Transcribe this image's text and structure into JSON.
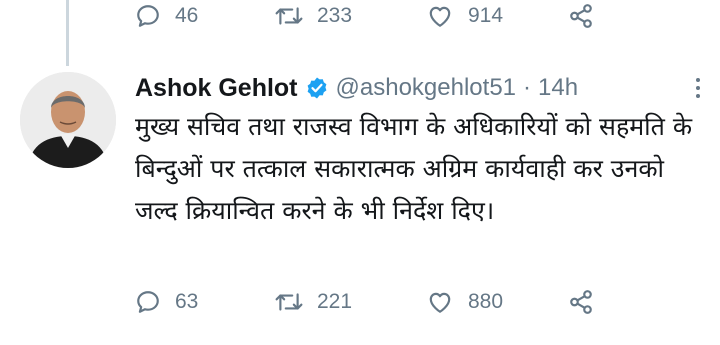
{
  "previous_tweet": {
    "actions": {
      "reply_count": "46",
      "retweet_count": "233",
      "like_count": "914"
    }
  },
  "tweet": {
    "author": {
      "display_name": "Ashok Gehlot",
      "handle": "@ashokgehlot51",
      "verified": true
    },
    "separator": "·",
    "time": "14h",
    "text": "मुख्य सचिव तथा राजस्व विभाग के अधिकारियों को सहमति के बिन्दुओं पर तत्काल सकारात्मक अग्रिम कार्यवाही कर उनको जल्द क्रियान्वित करने के भी निर्देश दिए।",
    "actions": {
      "reply_count": "63",
      "retweet_count": "221",
      "like_count": "880"
    }
  },
  "icons": {
    "reply": "reply-icon",
    "retweet": "retweet-icon",
    "like": "heart-icon",
    "share": "share-icon",
    "verified": "verified-badge-icon",
    "more": "more-icon"
  },
  "colors": {
    "text_primary": "#14171a",
    "text_secondary": "#657786",
    "verified_blue": "#1da1f2",
    "thread_line": "#ccd6dd"
  }
}
